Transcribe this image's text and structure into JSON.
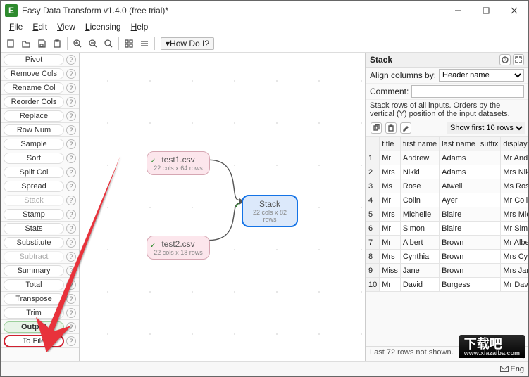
{
  "window": {
    "title": "Easy Data Transform v1.4.0 (free trial)*",
    "appicon_glyph": "E"
  },
  "menubar": [
    "File",
    "Edit",
    "View",
    "Licensing",
    "Help"
  ],
  "toolbar": {
    "howdoi": "▾How Do I?"
  },
  "sidebar": [
    {
      "label": "Pivot",
      "disabled": false,
      "header": false
    },
    {
      "label": "Remove Cols",
      "disabled": false
    },
    {
      "label": "Rename Col",
      "disabled": false
    },
    {
      "label": "Reorder Cols",
      "disabled": false
    },
    {
      "label": "Replace",
      "disabled": false
    },
    {
      "label": "Row Num",
      "disabled": false
    },
    {
      "label": "Sample",
      "disabled": false
    },
    {
      "label": "Sort",
      "disabled": false
    },
    {
      "label": "Split Col",
      "disabled": false
    },
    {
      "label": "Spread",
      "disabled": false
    },
    {
      "label": "Stack",
      "disabled": true
    },
    {
      "label": "Stamp",
      "disabled": false
    },
    {
      "label": "Stats",
      "disabled": false
    },
    {
      "label": "Substitute",
      "disabled": false
    },
    {
      "label": "Subtract",
      "disabled": true
    },
    {
      "label": "Summary",
      "disabled": false
    },
    {
      "label": "Total",
      "disabled": false
    },
    {
      "label": "Transpose",
      "disabled": false
    },
    {
      "label": "Trim",
      "disabled": false
    },
    {
      "label": "Output",
      "header": true
    },
    {
      "label": "To File",
      "tofile": true
    }
  ],
  "canvas": {
    "nodes": {
      "test1": {
        "title": "test1.csv",
        "sub": "22 cols x 64 rows"
      },
      "test2": {
        "title": "test2.csv",
        "sub": "22 cols x 18 rows"
      },
      "stack": {
        "title": "Stack",
        "sub": "22 cols x 82 rows"
      }
    }
  },
  "rpanel": {
    "title": "Stack",
    "align_label": "Align columns by:",
    "align_value": "Header name",
    "comment_label": "Comment:",
    "comment_value": "",
    "desc": "Stack rows of all inputs. Orders by the vertical (Y) position of the input datasets.",
    "show_rows": "Show first 10 rows",
    "columns": [
      "",
      "title",
      "first name",
      "last name",
      "suffix",
      "display nam"
    ],
    "rows": [
      [
        "1",
        "Mr",
        "Andrew",
        "Adams",
        "",
        "Mr Andrew"
      ],
      [
        "2",
        "Mrs",
        "Nikki",
        "Adams",
        "",
        "Mrs Nikki A"
      ],
      [
        "3",
        "Ms",
        "Rose",
        "Atwell",
        "",
        "Ms Rose At"
      ],
      [
        "4",
        "Mr",
        "Colin",
        "Ayer",
        "",
        "Mr Colin Ay"
      ],
      [
        "5",
        "Mrs",
        "Michelle",
        "Blaire",
        "",
        "Mrs Michell"
      ],
      [
        "6",
        "Mr",
        "Simon",
        "Blaire",
        "",
        "Mr Simon B"
      ],
      [
        "7",
        "Mr",
        "Albert",
        "Brown",
        "",
        "Mr Albert B"
      ],
      [
        "8",
        "Mrs",
        "Cynthia",
        "Brown",
        "",
        "Mrs Cynthia"
      ],
      [
        "9",
        "Miss",
        "Jane",
        "Brown",
        "",
        "Mrs Jane Br"
      ],
      [
        "10",
        "Mr",
        "David",
        "Burgess",
        "",
        "Mr David B"
      ]
    ],
    "footer": "Last 72 rows not shown."
  },
  "status": {
    "email": "Eng"
  },
  "watermark": {
    "big": "下载吧",
    "small": "www.xiazaiba.com"
  }
}
